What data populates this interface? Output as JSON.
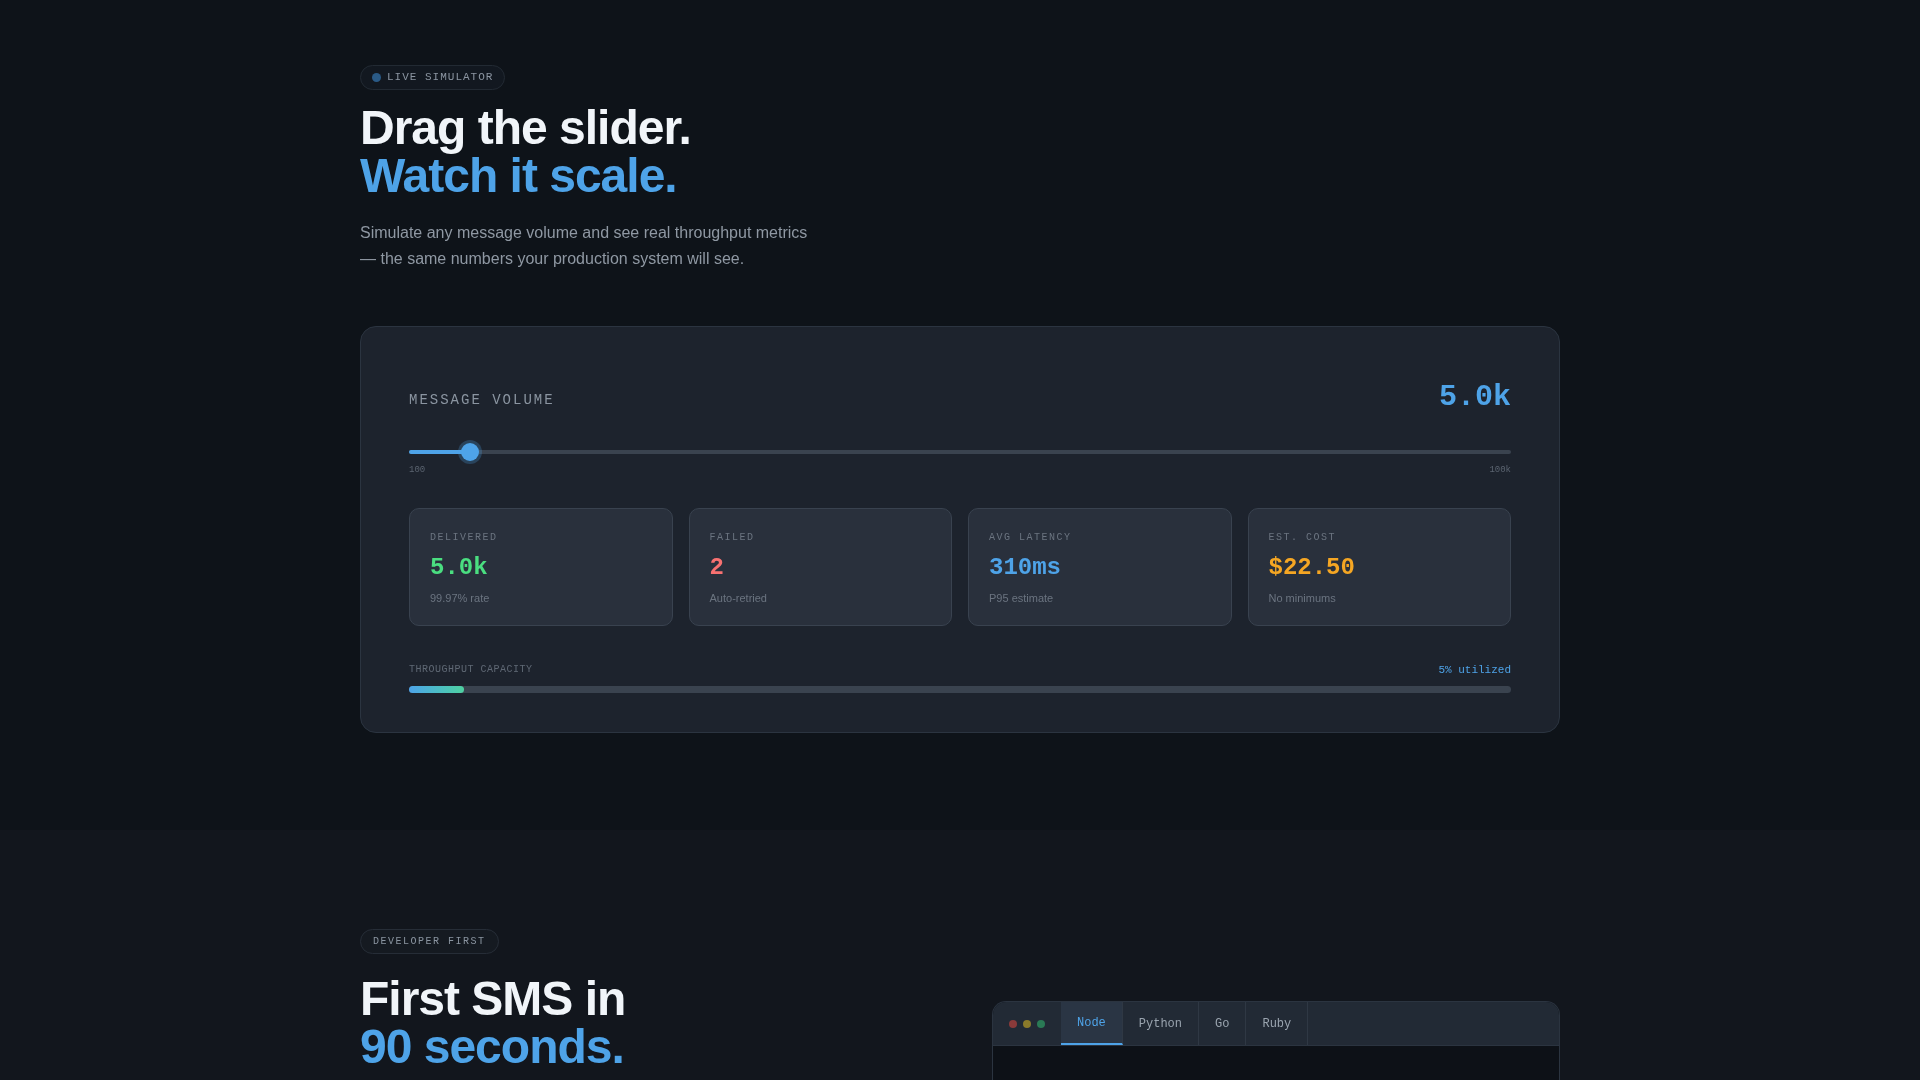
{
  "hero": {
    "badge": "LIVE SIMULATOR",
    "title": "Drag the slider.",
    "title_accent": "Watch it scale.",
    "description": "Simulate any message volume and see real throughput metrics — the same numbers your production system will see."
  },
  "simulator": {
    "label": "MESSAGE VOLUME",
    "value": "5.0k",
    "slider": {
      "level": 0.055,
      "min_label": "100",
      "max_label": "100k"
    },
    "stats": [
      {
        "label": "DELIVERED",
        "value": "5.0k",
        "note": "99.97% rate",
        "color": "#4ade80"
      },
      {
        "label": "FAILED",
        "value": "2",
        "note": "Auto-retried",
        "color": "#f87171"
      },
      {
        "label": "AVG LATENCY",
        "value": "310ms",
        "note": "P95 estimate",
        "color": "#4ea3e8"
      },
      {
        "label": "EST. COST",
        "value": "$22.50",
        "note": "No minimums",
        "color": "#f5a623"
      }
    ],
    "capacity": {
      "label": "THROUGHPUT CAPACITY",
      "reading": "5% utilized",
      "level": 0.05
    }
  },
  "developer": {
    "badge": "DEVELOPER FIRST",
    "title": "First SMS in",
    "title_accent": "90 seconds.",
    "code_window": {
      "tabs": [
        {
          "label": "Node",
          "selected": true
        },
        {
          "label": "Python",
          "selected": false
        },
        {
          "label": "Go",
          "selected": false
        },
        {
          "label": "Ruby",
          "selected": false
        }
      ]
    }
  }
}
